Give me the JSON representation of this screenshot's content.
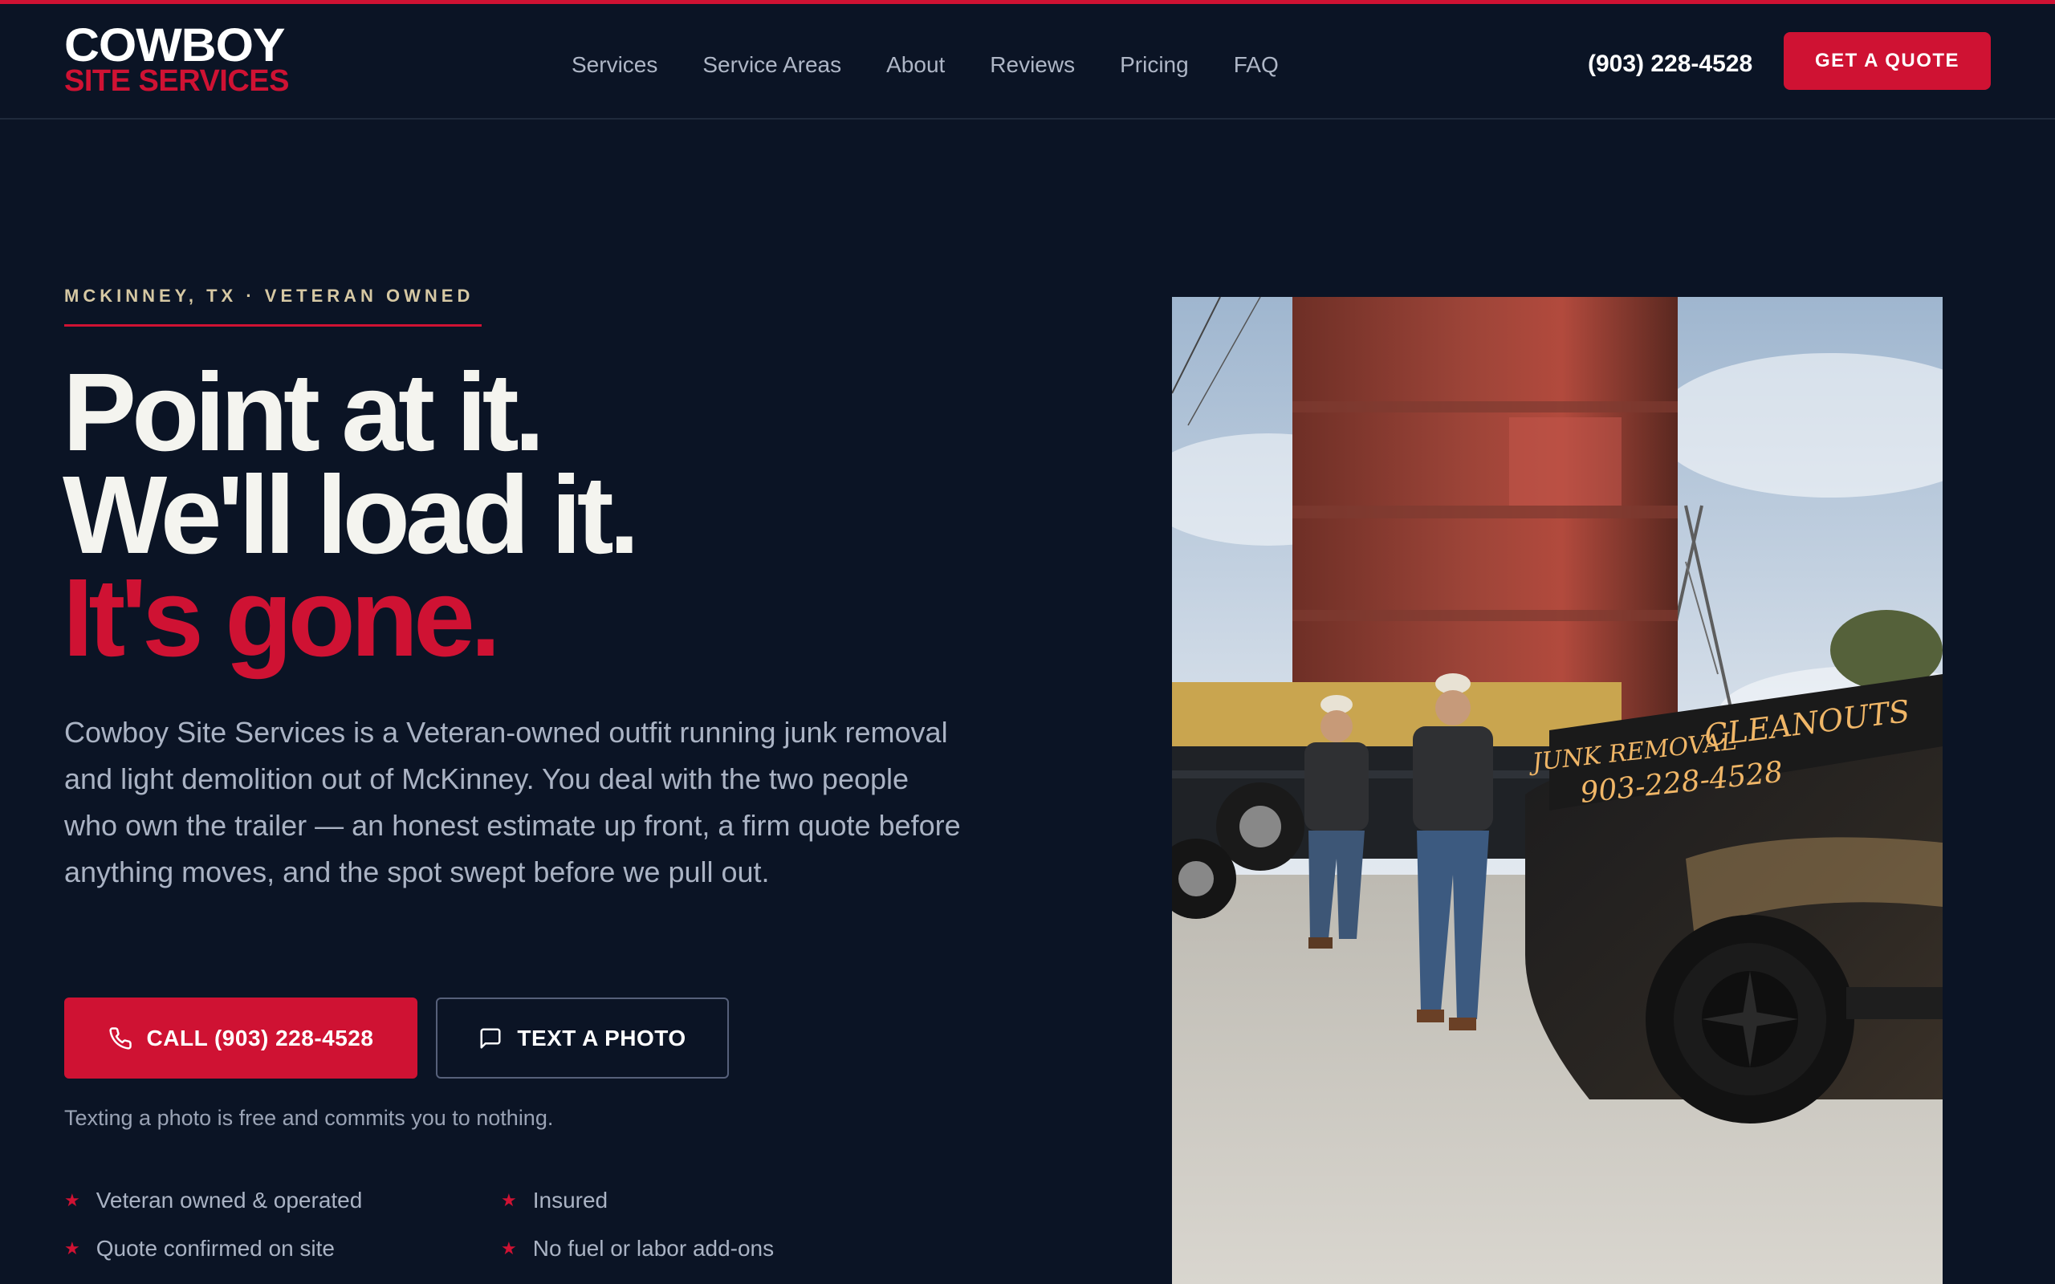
{
  "brand": {
    "line1": "COWBOY",
    "line2": "SITE SERVICES"
  },
  "nav": [
    "Services",
    "Service Areas",
    "About",
    "Reviews",
    "Pricing",
    "FAQ"
  ],
  "header": {
    "phone": "(903) 228-4528",
    "cta": "GET A QUOTE"
  },
  "hero": {
    "eyebrow": "MCKINNEY, TX · VETERAN OWNED",
    "line1": "Point at it.",
    "line2": "We'll load it.",
    "line3": "It's gone.",
    "lede": "Cowboy Site Services is a Veteran-owned outfit running junk removal and light demolition out of McKinney. You deal with the two people who own the trailer — an honest estimate up front, a firm quote before anything moves, and the spot swept before we pull out.",
    "call_label": "CALL (903) 228-4528",
    "text_label": "TEXT A PHOTO",
    "note": "Texting a photo is free and commits you to nothing."
  },
  "features": [
    "Veteran owned & operated",
    "Insured",
    "Quote confirmed on site",
    "No fuel or labor add-ons"
  ],
  "photo_text": {
    "truck_left": "JUNK REMOVAL",
    "truck_right": "CLEANOUTS",
    "truck_phone": "903-228-4528"
  },
  "colors": {
    "background": "#0b1425",
    "accent": "#cf1233",
    "eyebrow": "#d6c8a3"
  },
  "icons": {
    "call": "phone-icon",
    "text": "message-icon",
    "bullet": "star-icon"
  }
}
